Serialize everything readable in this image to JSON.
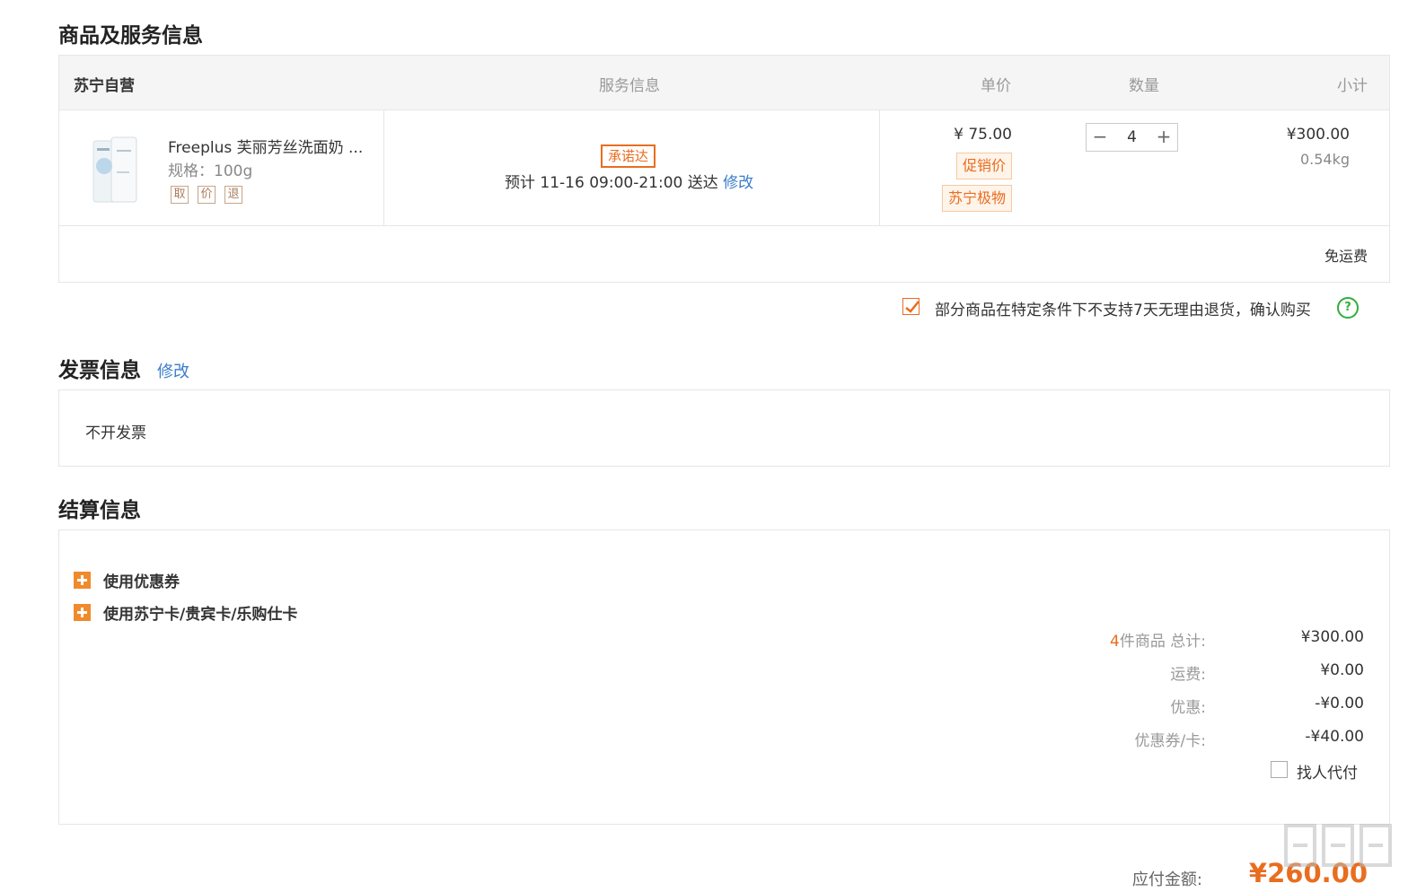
{
  "goods_section": {
    "title": "商品及服务信息",
    "header": {
      "shop": "苏宁自营",
      "service": "服务信息",
      "price": "单价",
      "quantity": "数量",
      "subtotal": "小计"
    },
    "item": {
      "name": "Freeplus 芙丽芳丝洗面奶 ...",
      "spec": "规格：100g",
      "tags": [
        "取",
        "价",
        "退"
      ],
      "promise_badge": "承诺达",
      "delivery": "预计 11-16 09:00-21:00  送达",
      "delivery_edit": "修改",
      "unit_price": "¥ 75.00",
      "badges": [
        "促销价",
        "苏宁极物"
      ],
      "minus": "−",
      "quantity": "4",
      "plus": "+",
      "subtotal": "¥300.00",
      "weight": "0.54kg"
    },
    "freight": "免运费"
  },
  "confirm": {
    "text": "部分商品在特定条件下不支持7天无理由退货，确认购买",
    "checked": true,
    "help": "?"
  },
  "invoice": {
    "title": "发票信息",
    "edit": "修改",
    "value": "不开发票"
  },
  "settlement": {
    "title": "结算信息",
    "coupon": "使用优惠券",
    "cards": "使用苏宁卡/贵宾卡/乐购仕卡",
    "count": "4",
    "total_label": "件商品 总计:",
    "total": "¥300.00",
    "shipping_label": "运费:",
    "shipping": "¥0.00",
    "discount_label": "优惠:",
    "discount": "-¥0.00",
    "coupon_label": "优惠券/卡:",
    "coupon_amount": "-¥40.00",
    "proxy_pay": "找人代付"
  },
  "payable": {
    "label": "应付金额:",
    "amount": "¥260.00"
  },
  "colors": {
    "accent": "#e96d1f",
    "link": "#3a7dc9",
    "help": "#2fae3b"
  }
}
